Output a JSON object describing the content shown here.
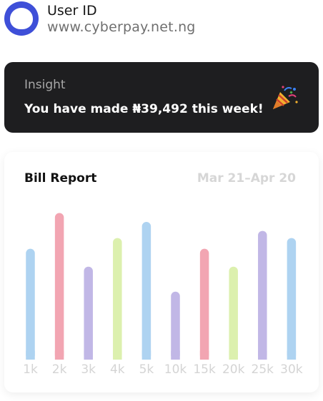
{
  "header": {
    "user_id": "User ID",
    "site": "www.cyberpay.net.ng",
    "avatar_color": "#3e4fd8"
  },
  "insight": {
    "label": "Insight",
    "message": "You have made ₦39,492 this week!",
    "icon": "party-popper-icon"
  },
  "card": {
    "title": "Bill Report",
    "range": "Mar 21–Apr 20"
  },
  "chart_data": {
    "type": "bar",
    "title": "Bill Report",
    "categories": [
      "1k",
      "2k",
      "3k",
      "4k",
      "5k",
      "10k",
      "15k",
      "20k",
      "25k",
      "30k"
    ],
    "values": [
      62,
      82,
      52,
      68,
      77,
      38,
      62,
      52,
      72,
      68
    ],
    "colors": [
      "#aed3f1",
      "#f2a5b2",
      "#c1b7e6",
      "#dcf0ae",
      "#aed3f1",
      "#c1b7e6",
      "#f2a5b2",
      "#dcf0ae",
      "#c1b7e6",
      "#aed3f1"
    ],
    "ylim": [
      0,
      85
    ],
    "grid": false,
    "xlabel": "",
    "ylabel": ""
  }
}
